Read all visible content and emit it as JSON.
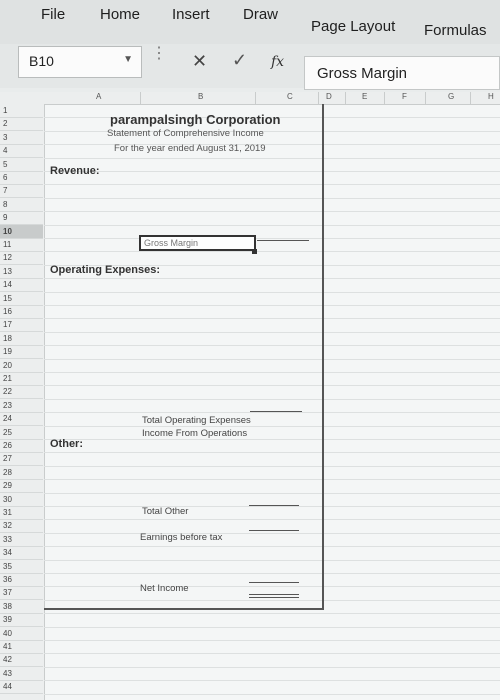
{
  "ribbon": {
    "tabs": [
      "File",
      "Home",
      "Insert",
      "Draw",
      "Page Layout",
      "Formulas"
    ]
  },
  "formula_bar": {
    "name_box": "B10",
    "formula": "Gross Margin"
  },
  "columns": [
    "A",
    "B",
    "C",
    "D",
    "E",
    "F",
    "G",
    "H"
  ],
  "rows": [
    "1",
    "2",
    "3",
    "4",
    "5",
    "6",
    "7",
    "8",
    "9",
    "10",
    "11",
    "12",
    "13",
    "14",
    "15",
    "16",
    "17",
    "18",
    "19",
    "20",
    "21",
    "22",
    "23",
    "24",
    "25",
    "26",
    "27",
    "28",
    "29",
    "30",
    "31",
    "32",
    "33",
    "34",
    "35",
    "36",
    "37",
    "38",
    "39",
    "40",
    "41",
    "42",
    "43",
    "44"
  ],
  "selected_row": "10",
  "report": {
    "company": "parampalsingh Corporation",
    "subtitle": "Statement of Comprehensive Income",
    "period": "For the year ended August 31, 2019",
    "revenue_label": "Revenue:",
    "gross_margin_label": "Gross Margin",
    "operating_expenses_label": "Operating Expenses:",
    "total_operating_expenses": "Total Operating Expenses",
    "income_from_operations": "Income From Operations",
    "other_label": "Other:",
    "total_other": "Total Other",
    "earnings_before_tax": "Earnings before tax",
    "net_income": "Net Income"
  }
}
